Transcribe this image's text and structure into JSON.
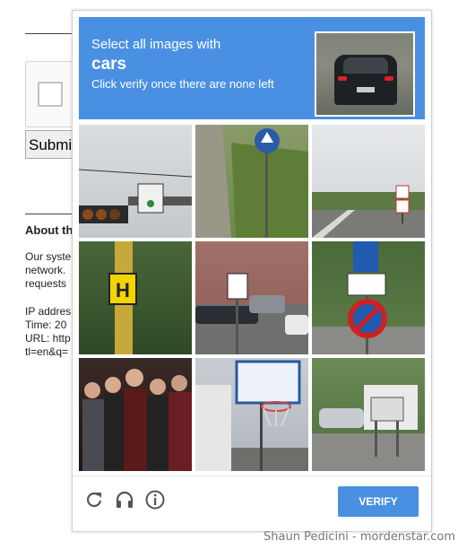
{
  "background_page": {
    "submit_label": "Submit",
    "about_heading": "About th",
    "lines": [
      "Our syste",
      "network.",
      "requests",
      "",
      "IP addres",
      "Time: 20",
      "URL: http",
      "tl=en&q="
    ]
  },
  "challenge": {
    "instruction_line1": "Select all images with",
    "target_object": "cars",
    "instruction_line3": "Click verify once there are none left",
    "tiles": [
      {
        "index": 1,
        "content": "traffic light with street sign"
      },
      {
        "index": 2,
        "content": "grassy road with blue sign"
      },
      {
        "index": 3,
        "content": "road with speed signs"
      },
      {
        "index": 4,
        "content": "yellow H sign on pole"
      },
      {
        "index": 5,
        "content": "parking lot with cars and arrow sign"
      },
      {
        "index": 6,
        "content": "no parking sign with bicycle sign"
      },
      {
        "index": 7,
        "content": "group of people"
      },
      {
        "index": 8,
        "content": "basketball hoop"
      },
      {
        "index": 9,
        "content": "road with car and sign"
      }
    ]
  },
  "footer": {
    "reload_icon": "reload-icon",
    "audio_icon": "headphones-icon",
    "info_icon": "info-icon",
    "verify_label": "VERIFY"
  },
  "colors": {
    "accent": "#4a90e2"
  },
  "credit": "Shaun Pedicini - mordenstar.com"
}
